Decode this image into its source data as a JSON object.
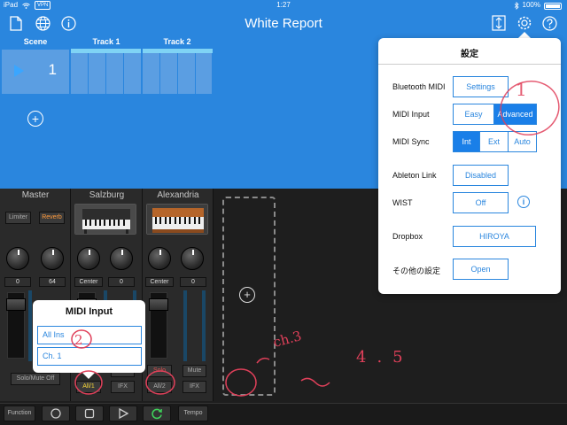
{
  "status": {
    "carrier": "iPad",
    "vpn": "VPN",
    "time": "1:27",
    "battery": "100%"
  },
  "nav": {
    "title": "White Report"
  },
  "session": {
    "scene_header": "Scene",
    "tracks": [
      "Track 1",
      "Track 2"
    ],
    "scene_number": "1"
  },
  "mixer": {
    "channels": [
      "Master",
      "Salzburg",
      "Alexandria"
    ],
    "limiter": "Limiter",
    "reverb": "Reverb",
    "values": [
      "0",
      "64",
      "Center",
      "0",
      "Center",
      "0"
    ],
    "mute": "Mute",
    "solo": "Solo",
    "solo_mute_off": "Solo/Mute Off",
    "all1": "All/1",
    "all2": "All/2",
    "ifx": "IFX"
  },
  "transport": {
    "function": "Function",
    "tempo": "Tempo"
  },
  "settings": {
    "title": "設定",
    "bluetooth_label": "Bluetooth MIDI",
    "bluetooth_btn": "Settings",
    "midi_input_label": "MIDI Input",
    "midi_input_options": [
      "Easy",
      "Advanced"
    ],
    "midi_sync_label": "MIDI Sync",
    "midi_sync_options": [
      "Int",
      "Ext",
      "Auto"
    ],
    "ableton_label": "Ableton Link",
    "ableton_btn": "Disabled",
    "wist_label": "WIST",
    "wist_btn": "Off",
    "dropbox_label": "Dropbox",
    "dropbox_btn": "HIROYA",
    "other_label": "その他の設定",
    "other_btn": "Open"
  },
  "midi_popover": {
    "title": "MIDI Input",
    "options": [
      "All Ins",
      "Ch. 1"
    ]
  },
  "annotations": [
    "1",
    "2",
    "ch.3",
    "4.5"
  ],
  "colors": {
    "accent": "#2a86de",
    "selected": "#1a7fe8",
    "mixer_bg": "#1e1e1e",
    "annotation": "#e0405a"
  }
}
